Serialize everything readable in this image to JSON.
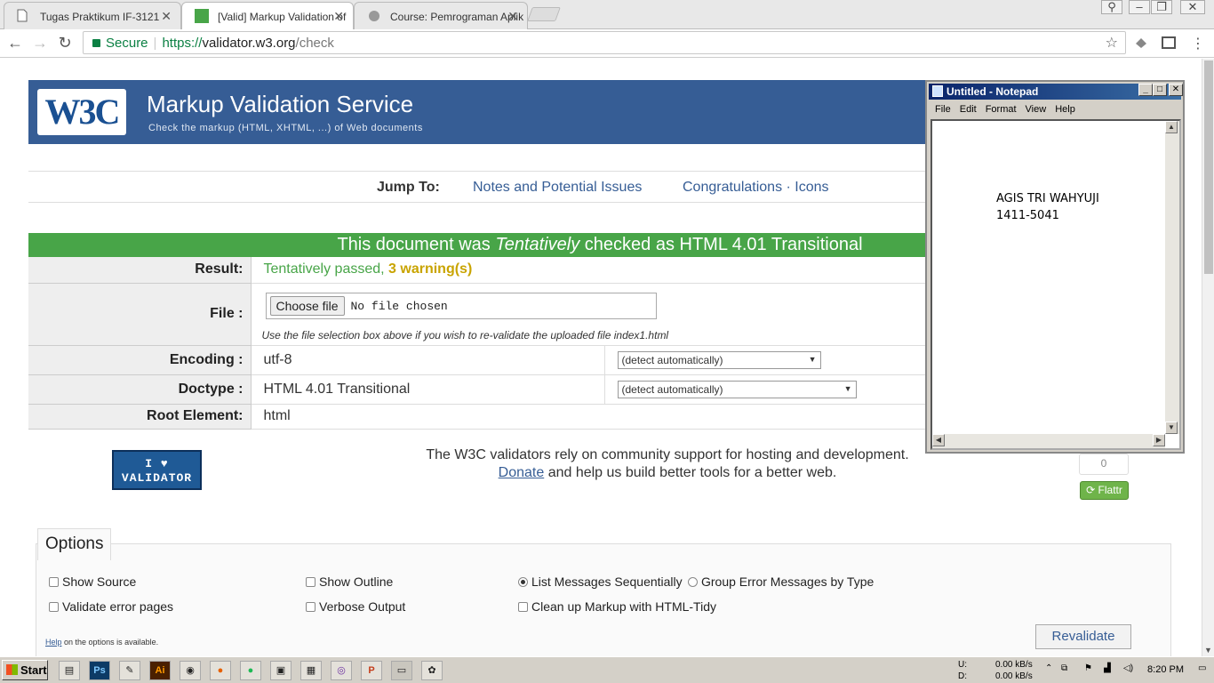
{
  "browser": {
    "tabs": [
      {
        "title": "Tugas Praktikum IF-3121"
      },
      {
        "title": "[Valid] Markup Validation of"
      },
      {
        "title": "Course: Pemrograman Aplik"
      }
    ],
    "secure_label": "Secure",
    "url_scheme": "https://",
    "url_host": "validator.w3.org",
    "url_path": "/check"
  },
  "header": {
    "logo": "W3C",
    "title": "Markup Validation Service",
    "subtitle": "Check the markup (HTML, XHTML, ...) of Web documents"
  },
  "jump": {
    "label": "Jump To:",
    "link_notes": "Notes and Potential Issues",
    "link_congrats": "Congratulations · Icons"
  },
  "result": {
    "banner_prefix": "This document was",
    "banner_em": "Tentatively",
    "banner_suffix": "checked as HTML 4.01 Transitional",
    "result_label": "Result:",
    "result_passed": "Tentatively passed,",
    "result_warnings": "3 warning(s)",
    "file_label": "File :",
    "choose_file": "Choose file",
    "no_file": "No file chosen",
    "file_hint": "Use the file selection box above if you wish to re-validate the uploaded file index1.html",
    "encoding_label": "Encoding :",
    "encoding_value": "utf-8",
    "encoding_select": "(detect automatically)",
    "doctype_label": "Doctype :",
    "doctype_value": "HTML 4.01 Transitional",
    "doctype_select": "(detect automatically)",
    "root_label": "Root Element:",
    "root_value": "html"
  },
  "support": {
    "badge_line1": "I ♥",
    "badge_line2": "VALIDATOR",
    "text1": "The W3C validators rely on community support for hosting and development.",
    "donate": "Donate",
    "text2": "and help us build better tools for a better web.",
    "flattr_count": "0",
    "flattr_label": "Flattr"
  },
  "options": {
    "legend": "Options",
    "show_source": "Show Source",
    "show_outline": "Show Outline",
    "list_sequential": "List Messages Sequentially",
    "group_by_type": "Group Error Messages by Type",
    "validate_error_pages": "Validate error pages",
    "verbose_output": "Verbose Output",
    "clean_up": "Clean up Markup with HTML-Tidy",
    "help_link": "Help",
    "help_text": "on the options is available.",
    "revalidate": "Revalidate"
  },
  "notepad": {
    "title": "Untitled - Notepad",
    "menu": [
      "File",
      "Edit",
      "Format",
      "View",
      "Help"
    ],
    "line1": "AGIS TRI WAHYUJI",
    "line2": "1411-5041"
  },
  "taskbar": {
    "start": "Start",
    "net_up_label": "U:",
    "net_down_label": "D:",
    "net_up": "0.00 kB/s",
    "net_down": "0.00 kB/s",
    "clock": "8:20 PM"
  }
}
